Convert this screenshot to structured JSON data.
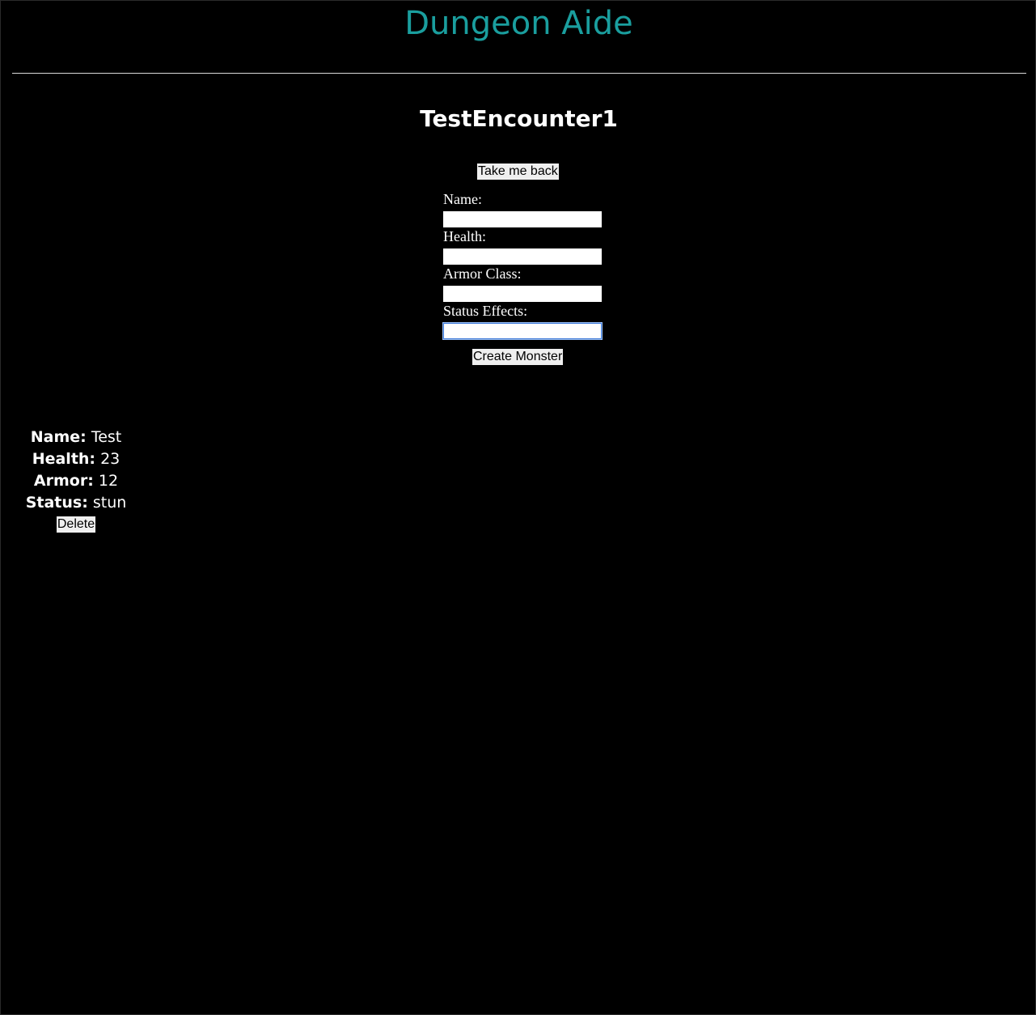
{
  "header": {
    "app_title": "Dungeon Aide",
    "title_color": "#1a9e9e"
  },
  "encounter": {
    "title": "TestEncounter1",
    "back_label": "Take me back"
  },
  "form": {
    "name_label": "Name:",
    "name_value": "",
    "health_label": "Health:",
    "health_value": "",
    "armor_label": "Armor Class:",
    "armor_value": "",
    "status_label": "Status Effects:",
    "status_value": "",
    "submit_label": "Create Monster"
  },
  "monsters": [
    {
      "name_label": "Name:",
      "name": "Test",
      "health_label": "Health:",
      "health": "23",
      "armor_label": "Armor:",
      "armor": "12",
      "status_label": "Status:",
      "status": "stun",
      "delete_label": "Delete"
    }
  ]
}
